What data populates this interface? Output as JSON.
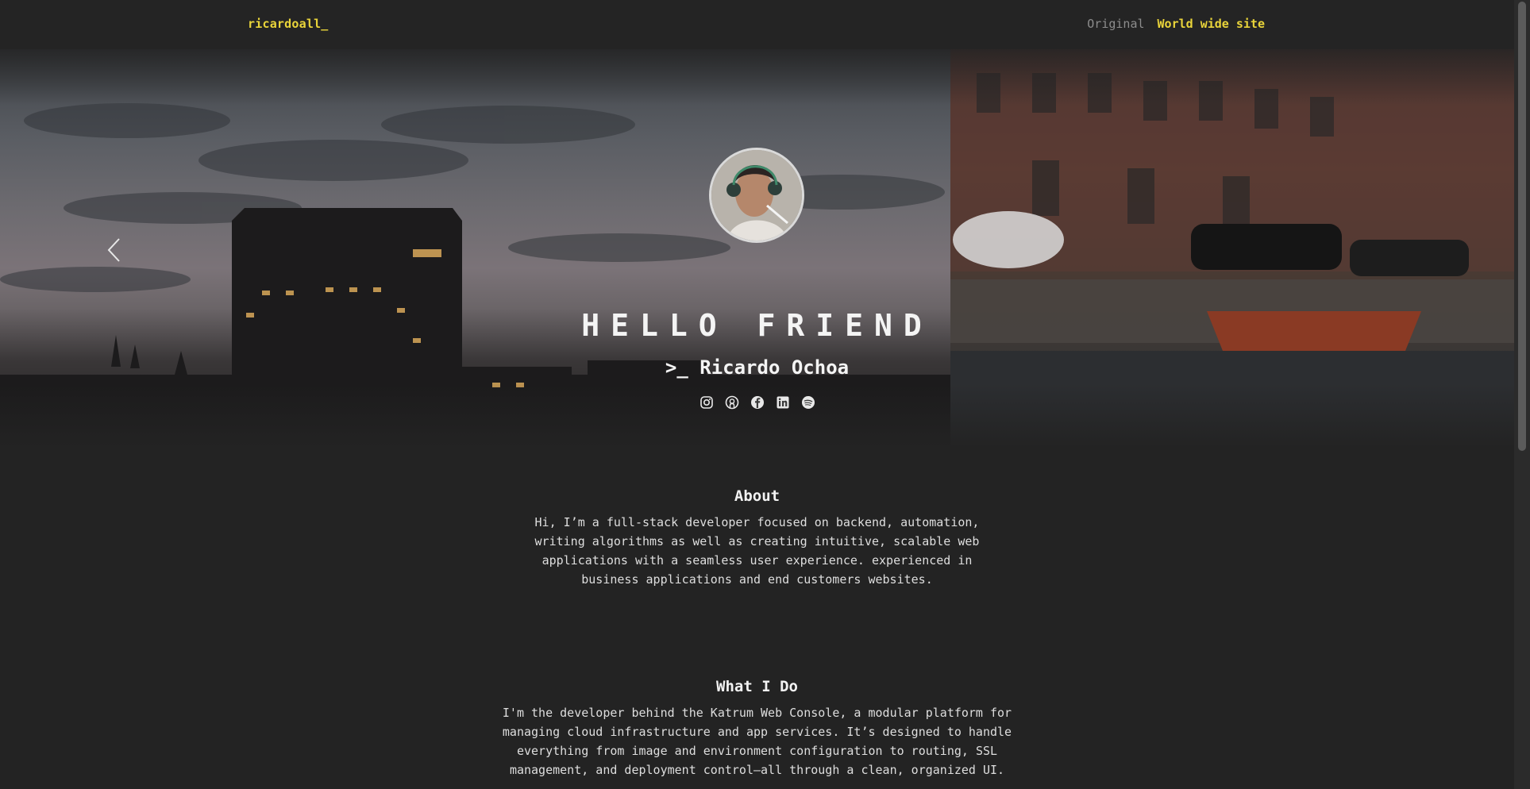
{
  "nav": {
    "brand": "ricardoall_",
    "links": [
      {
        "label": "Original",
        "active": false
      },
      {
        "label": "World wide site",
        "active": true
      }
    ]
  },
  "hero": {
    "title": "HELLO FRIEND",
    "subtitle": ">_ Ricardo Ochoa",
    "socials": [
      "instagram-icon",
      "github-icon",
      "facebook-icon",
      "linkedin-icon",
      "spotify-icon"
    ]
  },
  "about": {
    "heading": "About",
    "text": "Hi, I’m a full-stack developer focused on backend, automation, writing algorithms as well as creating intuitive, scalable web applications with a seamless user experience. experienced in business applications and end customers websites."
  },
  "what_i_do": {
    "heading": "What I Do",
    "text": "I'm the developer behind the Katrum Web Console, a modular platform for managing cloud infrastructure and app services. It’s designed to handle everything from image and environment configuration to routing, SSL management, and deployment control—all through a clean, organized UI."
  },
  "colors": {
    "background": "#232323",
    "accent": "#e9d43a",
    "muted_link": "#8d8d8d"
  }
}
